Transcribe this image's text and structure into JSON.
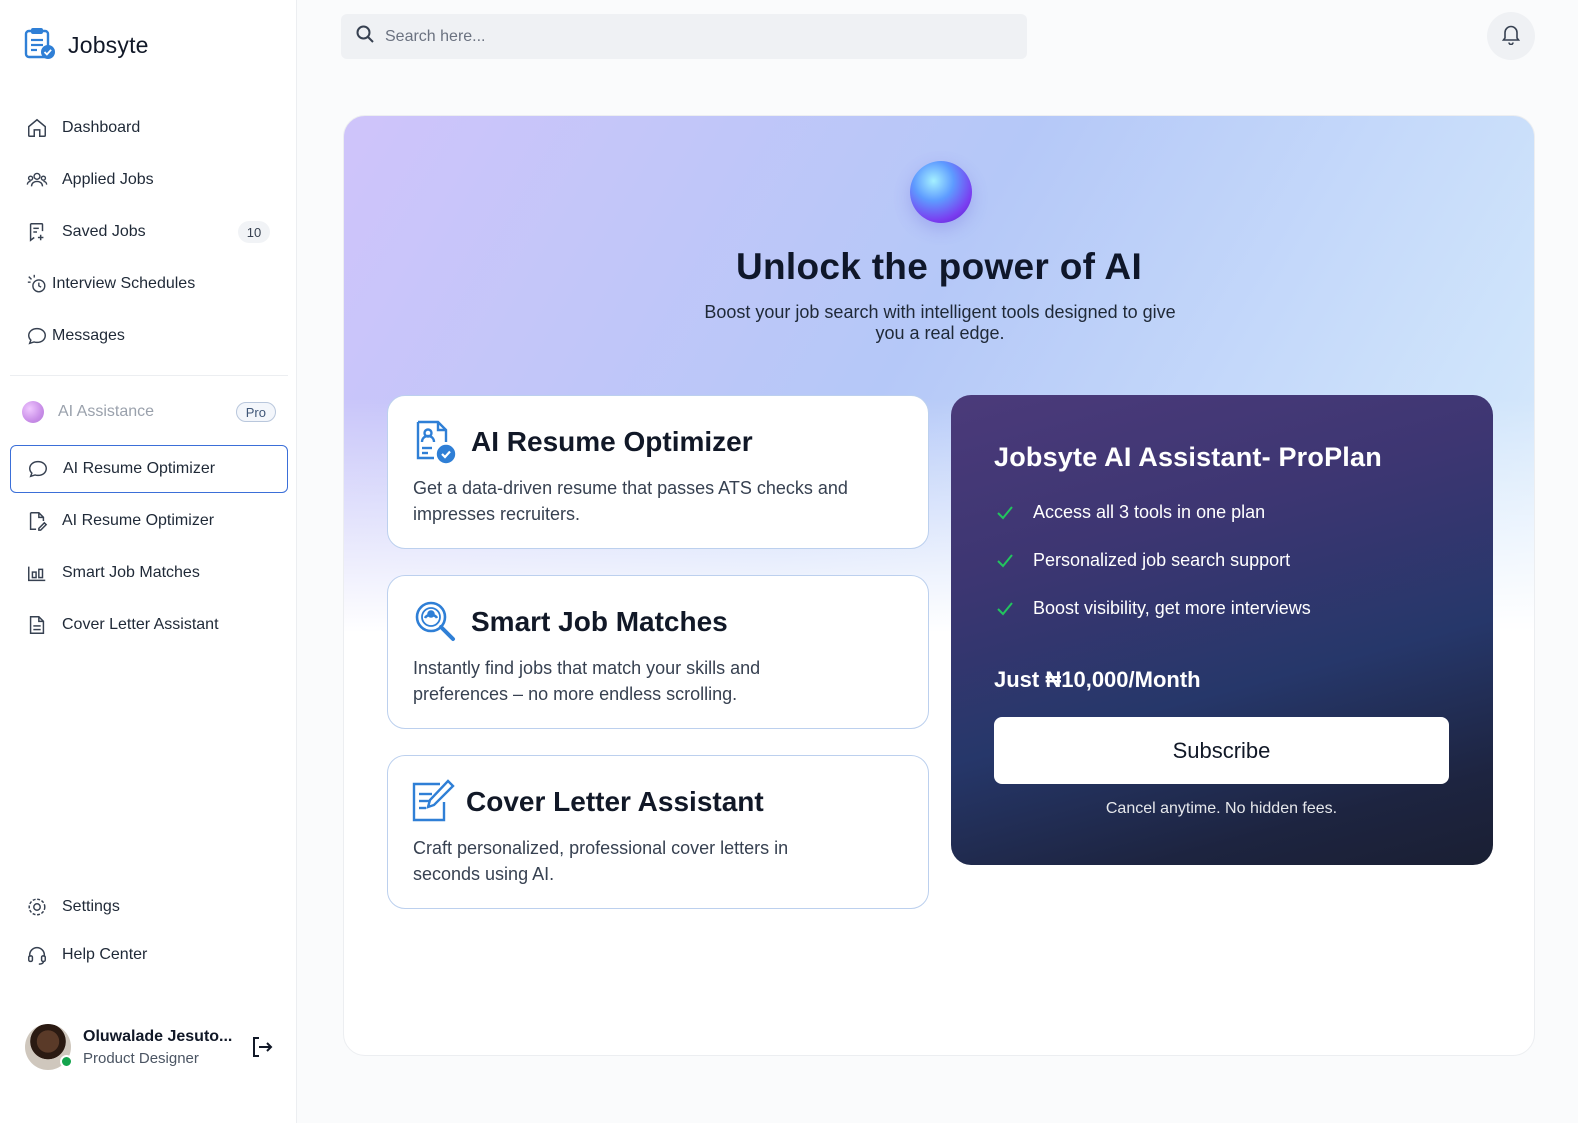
{
  "app": {
    "name": "Jobsyte"
  },
  "search": {
    "placeholder": "Search here..."
  },
  "sidebar": {
    "items": [
      {
        "label": "Dashboard",
        "icon": "home-icon"
      },
      {
        "label": "Applied Jobs",
        "icon": "users-icon"
      },
      {
        "label": "Saved Jobs",
        "icon": "bookmark-plus-icon",
        "count": "10"
      },
      {
        "label": "Interview Schedules",
        "icon": "calendar-clock-icon"
      },
      {
        "label": "Messages",
        "icon": "chat-icon"
      }
    ],
    "ai_section": {
      "label": "AI Assistance",
      "badge": "Pro"
    },
    "ai_items": [
      {
        "label": "AI Resume Optimizer",
        "icon": "chat-icon",
        "active": true
      },
      {
        "label": "AI Resume Optimizer",
        "icon": "document-edit-icon"
      },
      {
        "label": "Smart Job Matches",
        "icon": "chart-icon"
      },
      {
        "label": "Cover Letter Assistant",
        "icon": "document-icon"
      }
    ],
    "bottom_items": [
      {
        "label": "Settings",
        "icon": "gear-icon"
      },
      {
        "label": "Help Center",
        "icon": "headset-icon"
      }
    ],
    "user": {
      "name": "Oluwalade Jesuto...",
      "role": "Product Designer",
      "status": "online"
    }
  },
  "hero": {
    "title": "Unlock the power of AI",
    "subtitle": "Boost your job search with intelligent tools designed to give you a real edge."
  },
  "features": [
    {
      "title": "AI Resume Optimizer",
      "description": "Get a data-driven resume that passes ATS checks and impresses recruiters.",
      "icon": "resume-check-icon"
    },
    {
      "title": "Smart Job Matches",
      "description": "Instantly find jobs that match your skills and preferences – no more endless scrolling.",
      "icon": "search-match-icon"
    },
    {
      "title": "Cover Letter Assistant",
      "description": "Craft personalized, professional cover letters in seconds using AI.",
      "icon": "edit-document-icon"
    }
  ],
  "plan": {
    "title": "Jobsyte AI Assistant- ProPlan",
    "features": [
      "Access all 3 tools in one plan",
      "Personalized job search support",
      "Boost visibility, get more interviews"
    ],
    "price": "Just ₦10,000/Month",
    "button_label": "Subscribe",
    "fine_print": "Cancel anytime. No hidden fees."
  },
  "colors": {
    "accent": "#3b6fd8",
    "feature_icon": "#2f7fd6",
    "check": "#22c55e",
    "online": "#14a44d"
  }
}
